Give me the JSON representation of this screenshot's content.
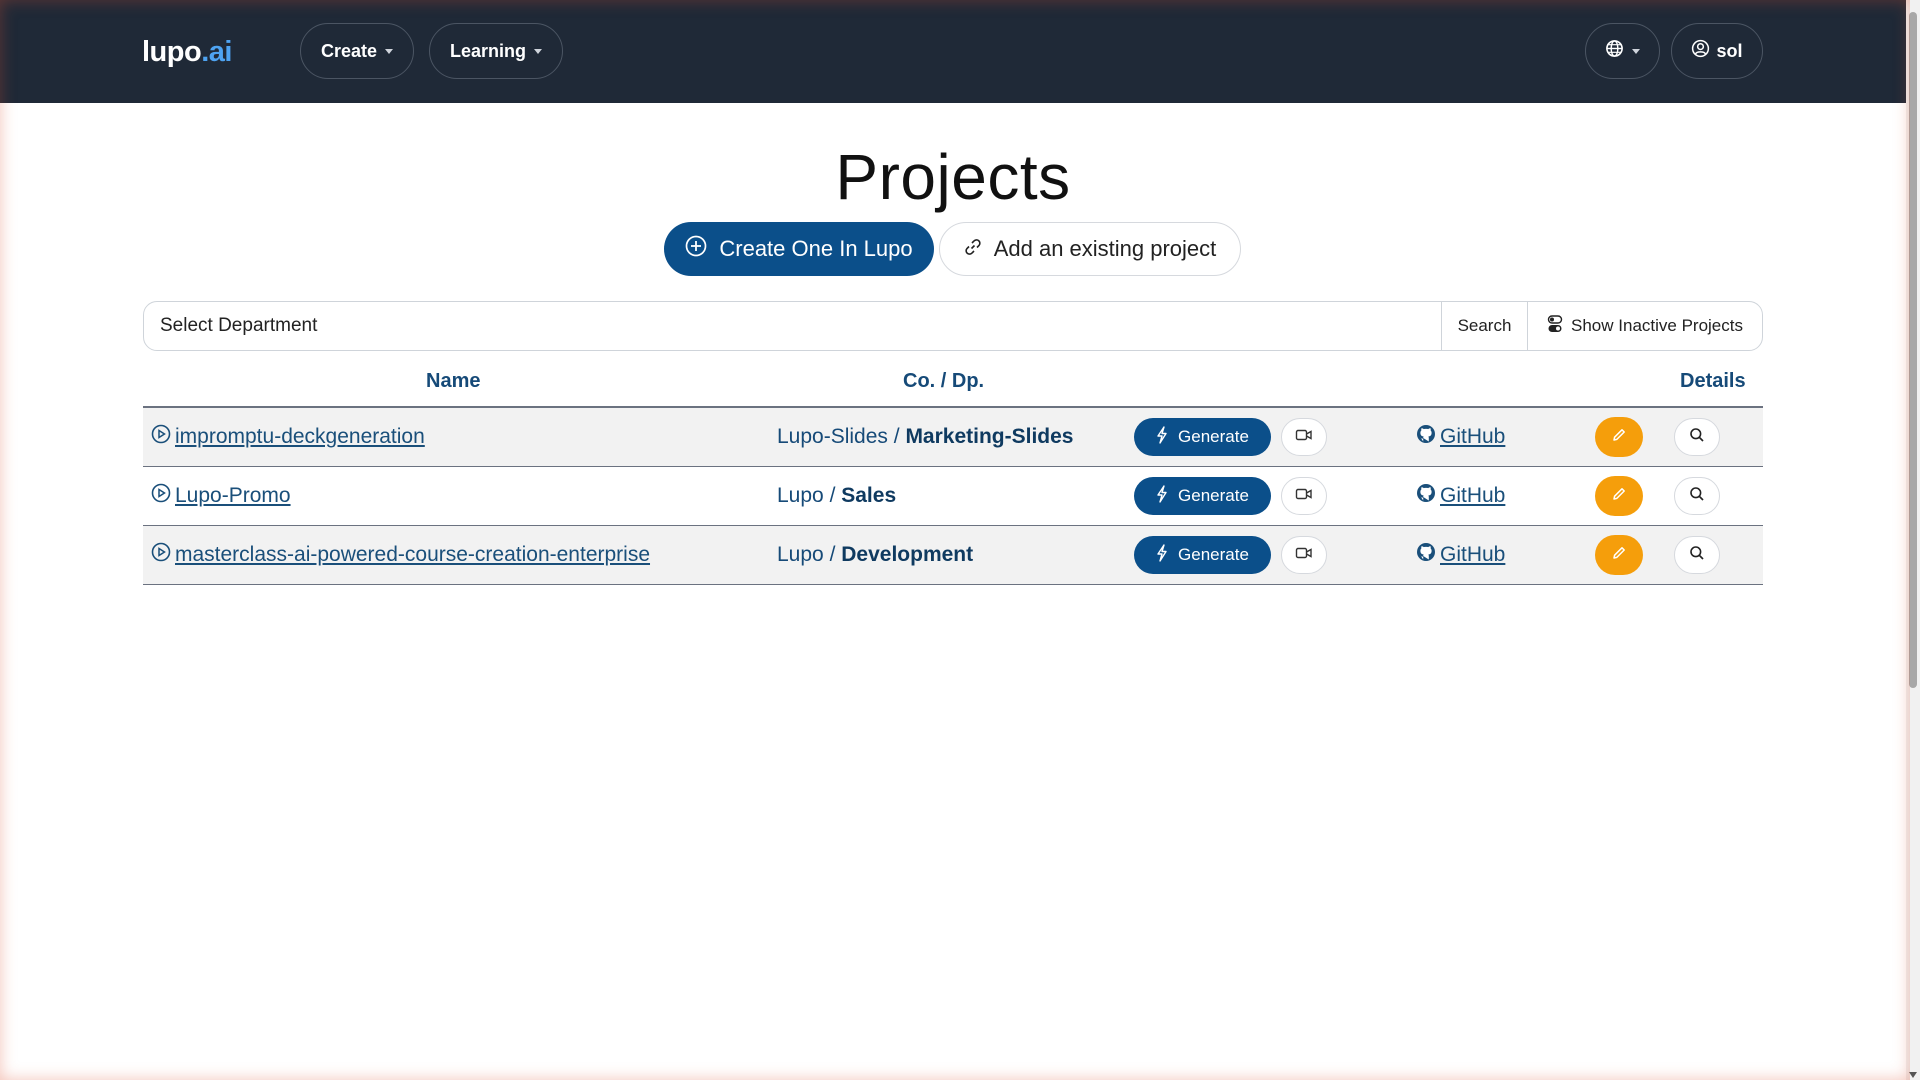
{
  "navbar": {
    "brand_main": "lupo",
    "brand_suffix": ".ai",
    "menus": [
      {
        "label": "Create"
      },
      {
        "label": "Learning"
      }
    ],
    "language_icon": "globe-icon",
    "user": {
      "label": "sol",
      "icon": "user-circle-icon"
    }
  },
  "page": {
    "title": "Projects",
    "create_button": "Create One In Lupo",
    "add_button": "Add an existing project"
  },
  "filters": {
    "department_placeholder": "Select Department",
    "search_label": "Search",
    "inactive_toggle_label": "Show Inactive Projects"
  },
  "table": {
    "headers": {
      "name": "Name",
      "co_dp": "Co. / Dp.",
      "details": "Details"
    },
    "rows": [
      {
        "name": "impromptu-deckgeneration",
        "company": "Lupo-Slides",
        "separator": "/",
        "department": "Marketing-Slides",
        "generate_label": "Generate",
        "github_label": "GitHub"
      },
      {
        "name": "Lupo-Promo",
        "company": "Lupo",
        "separator": "/",
        "department": "Sales",
        "generate_label": "Generate",
        "github_label": "GitHub"
      },
      {
        "name": "masterclass-ai-powered-course-creation-enterprise",
        "company": "Lupo",
        "separator": "/",
        "department": "Development",
        "generate_label": "Generate",
        "github_label": "GitHub"
      }
    ]
  },
  "colors": {
    "navbar_bg": "#1f2937",
    "brand_accent": "#4ea3f1",
    "primary": "#0b4f8a",
    "edit_orange": "#f59e0b",
    "header_text": "#164a78"
  }
}
